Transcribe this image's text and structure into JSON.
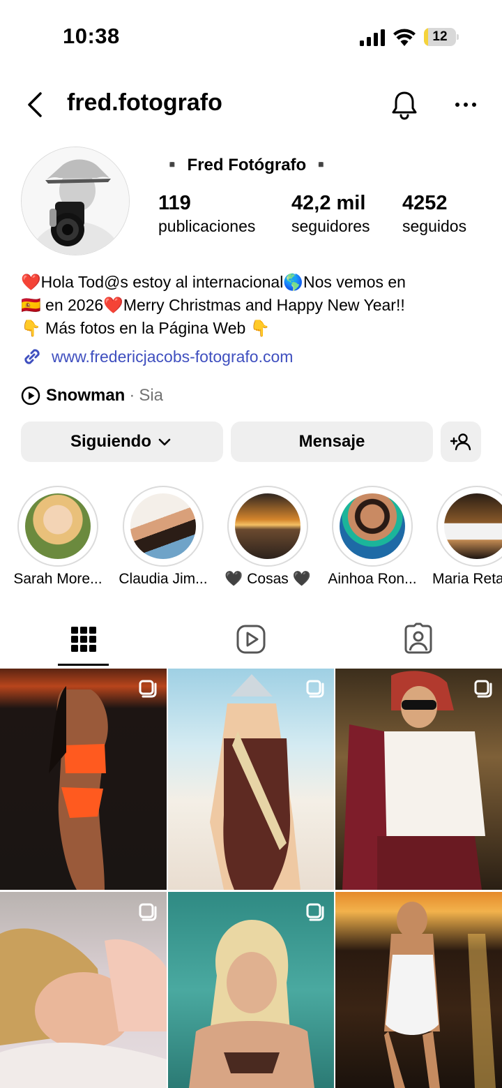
{
  "status_bar": {
    "time": "10:38",
    "battery": "12",
    "battery_level": 0.12
  },
  "header": {
    "username": "fred.fotografo",
    "back_icon": "chevron-left-icon",
    "bell_icon": "bell-icon",
    "more_icon": "more-horizontal-icon"
  },
  "profile": {
    "display_name": "▪️ Fred Fotógrafo ▪️",
    "stats": [
      {
        "value": "119",
        "label": "publicaciones"
      },
      {
        "value": "42,2 mil",
        "label": "seguidores"
      },
      {
        "value": "4252",
        "label": "seguidos"
      }
    ],
    "bio": {
      "line1": {
        "heart": "❤️",
        "text": "Hola Tod@s estoy al internacional",
        "globe": "🌎",
        "text2": "Nos vemos en"
      },
      "line2": {
        "flag": "🇪🇸",
        "text": " en 2026",
        "heart": "❤️",
        "text2": "Merry Christmas and Happy New Year!!"
      },
      "line3": {
        "emoji": "👇",
        "text": " Más fotos en la Página Web ",
        "emoji2": "👇"
      }
    },
    "website": "www.fredericjacobs-fotografo.com",
    "music": {
      "title": "Snowman",
      "separator": " · ",
      "artist": "Sia"
    }
  },
  "buttons": {
    "following": "Siguiendo",
    "message": "Mensaje",
    "add_icon": "add-user-icon"
  },
  "highlights": [
    {
      "label": "Sarah More..."
    },
    {
      "label": "Claudia Jim..."
    },
    {
      "label": "🖤 Cosas 🖤"
    },
    {
      "label": "Ainhoa Ron..."
    },
    {
      "label": "Maria Reta"
    }
  ],
  "tabs": [
    {
      "name": "grid",
      "icon": "grid-icon",
      "active": true
    },
    {
      "name": "reels",
      "icon": "reels-icon",
      "active": false
    },
    {
      "name": "tagged",
      "icon": "tagged-icon",
      "active": false
    }
  ],
  "colors": {
    "link": "#3f4fbf",
    "button_bg": "#efefef",
    "battery": "#f5d33b",
    "heart": "#e0143c"
  }
}
